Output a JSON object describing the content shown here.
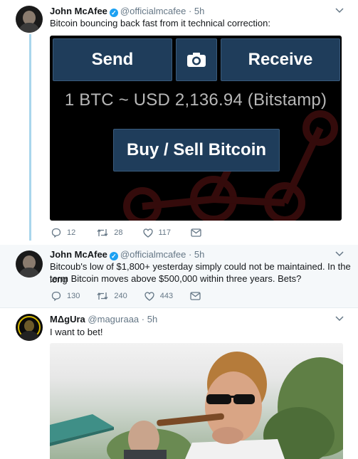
{
  "tweets": [
    {
      "author": "John McAfee",
      "handle": "@officialmcafee",
      "time": "· 5h",
      "text": "Bitcoin bouncing back fast from it technical correction:",
      "media": {
        "send_label": "Send",
        "receive_label": "Receive",
        "rate_text": "1 BTC ~ USD 2,136.94 (Bitstamp)",
        "buy_sell_label": "Buy / Sell Bitcoin"
      },
      "stats": {
        "replies": "12",
        "retweets": "28",
        "likes": "117"
      }
    },
    {
      "author": "John McAfee",
      "handle": "@officialmcafee",
      "time": "· 5h",
      "text_line1": "Bitcoub's low of $1,800+ yesterday simply could not be maintained. In the long",
      "text_line2": "term Bitcoin moves above  $500,000 within three years. Bets?",
      "stats": {
        "replies": "130",
        "retweets": "240",
        "likes": "443"
      }
    },
    {
      "author": "MΔgUra",
      "handle": "@maguraaa",
      "time": "· 5h",
      "text": "I want to bet!"
    }
  ],
  "colors": {
    "thread_line": "#a9d6ec",
    "verified": "#1da1f2",
    "wallet_button": "#1f3d5b",
    "alt_background": "#f5f8fa"
  },
  "icons": [
    "reply-icon",
    "retweet-icon",
    "like-icon",
    "message-icon",
    "camera-icon",
    "chevron-down-icon",
    "verified-badge-icon"
  ]
}
